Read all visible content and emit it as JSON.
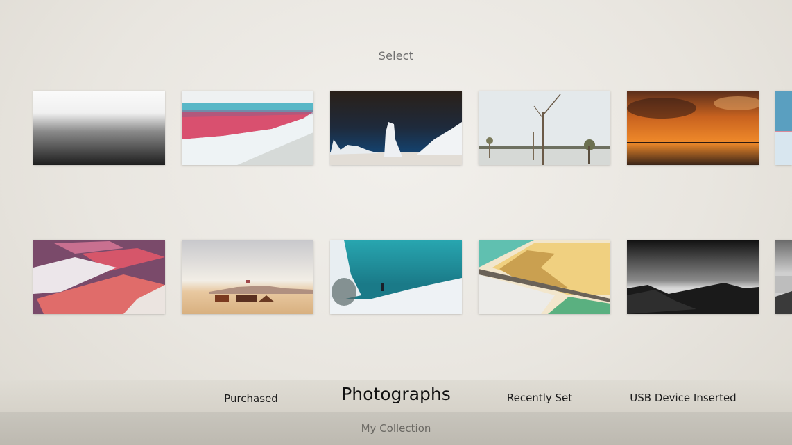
{
  "header": {
    "title": "Select"
  },
  "gallery": {
    "rows": [
      [
        {
          "name": "misty-sea-bw",
          "description": "Black and white misty sea"
        },
        {
          "name": "pink-salt-lake",
          "description": "Pink lagoon with white salt flats"
        },
        {
          "name": "inverted-ice-formations",
          "description": "Ice pillars under dark sky"
        },
        {
          "name": "dead-trees-in-water",
          "description": "Bare trees standing in a lake"
        },
        {
          "name": "orange-sunset-reflection",
          "description": "Fiery sunset clouds reflected on water"
        },
        {
          "name": "blue-lake-partial",
          "description": "Partially visible blue lake photo"
        }
      ],
      [
        {
          "name": "pink-salt-ponds-aerial",
          "description": "Aerial view of pink and white salt ponds"
        },
        {
          "name": "desert-camp-flag",
          "description": "Desert camp with people and flag"
        },
        {
          "name": "ice-cave",
          "description": "Turquoise ice cave with a person"
        },
        {
          "name": "yellow-evaporation-ponds",
          "description": "Aerial teal and yellow evaporation ponds"
        },
        {
          "name": "bw-mountain-horizon",
          "description": "Black and white mountain ridge at dusk"
        },
        {
          "name": "bw-coast-partial",
          "description": "Partially visible black and white coastline"
        }
      ]
    ]
  },
  "tabs": [
    {
      "label": "Purchased",
      "active": false
    },
    {
      "label": "Photographs",
      "active": true
    },
    {
      "label": "Recently Set",
      "active": false
    },
    {
      "label": "USB Device Inserted",
      "active": false
    }
  ],
  "footer": {
    "label": "My Collection"
  }
}
